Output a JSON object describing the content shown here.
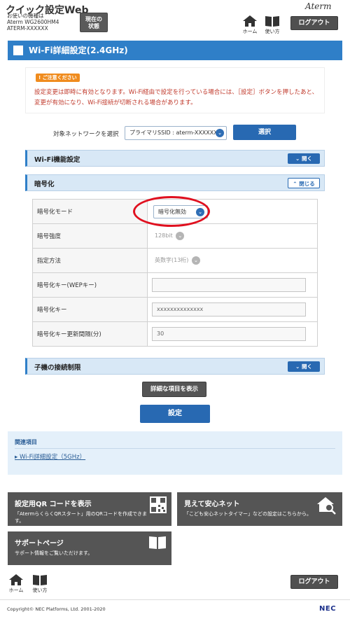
{
  "header": {
    "app_title": "クイック設定Web",
    "device_line1": "お使いの機種は",
    "device_line2": "Aterm WG2600HM4",
    "device_line3": "ATERM-XXXXXX",
    "status_line1": "現在の",
    "status_line2": "状態",
    "brand": "Aterm",
    "home_label": "ホーム",
    "help_label": "使い方",
    "logout_label": "ログアウト"
  },
  "page": {
    "title": "Wi-Fi詳細設定(2.4GHz)"
  },
  "notice": {
    "tag": "ご注意ください",
    "text": "設定変更は即時に有効となります。Wi-Fi経由で設定を行っている場合には、［設定］ボタンを押したあと、変更が有効になり、Wi-Fi接続が切断される場合があります。"
  },
  "target_network": {
    "label": "対象ネットワークを選択",
    "selected": "プライマリSSID : aterm-XXXXXX-g",
    "select_button": "選択"
  },
  "sections": {
    "wifi_function": {
      "title": "Wi-Fi機能設定",
      "toggle": "開く"
    },
    "encryption": {
      "title": "暗号化",
      "toggle": "閉じる"
    },
    "client_limit": {
      "title": "子機の接続制限",
      "toggle": "開く"
    }
  },
  "encryption_rows": {
    "mode_label": "暗号化モード",
    "mode_value": "暗号化無効",
    "strength_label": "暗号強度",
    "strength_value": "128bit",
    "method_label": "指定方法",
    "method_value": "英数字(13桁)",
    "wep_label": "暗号化キー(WEPキー)",
    "wep_value": "",
    "key_label": "暗号化キー",
    "key_value": "xxxxxxxxxxxxxx",
    "interval_label": "暗号化キー更新間隔(分)",
    "interval_value": "30"
  },
  "actions": {
    "advanced_label": "詳細な項目を表示",
    "submit_label": "設定"
  },
  "related": {
    "title": "関連項目",
    "link": "Wi-Fi詳細設定（5GHz）"
  },
  "tiles": {
    "qr_title": "設定用QR コードを表示",
    "qr_desc": "「AtermらくらくQRスタート」用のQRコードを作成できます。",
    "safe_title": "見えて安心ネット",
    "safe_desc": "「こども安心ネットタイマー」などの設定はこちらから。",
    "support_title": "サポートページ",
    "support_desc": "サポート情報をご覧いただけます。"
  },
  "footer": {
    "home_label": "ホーム",
    "help_label": "使い方",
    "logout_label": "ログアウト",
    "copyright": "Copyright© NEC Platforms, Ltd. 2001-2020",
    "nec": "NEC"
  },
  "colors": {
    "accent_blue": "#2f7fc8",
    "notice_red": "#c0392b",
    "highlight_red": "#e0101f"
  }
}
